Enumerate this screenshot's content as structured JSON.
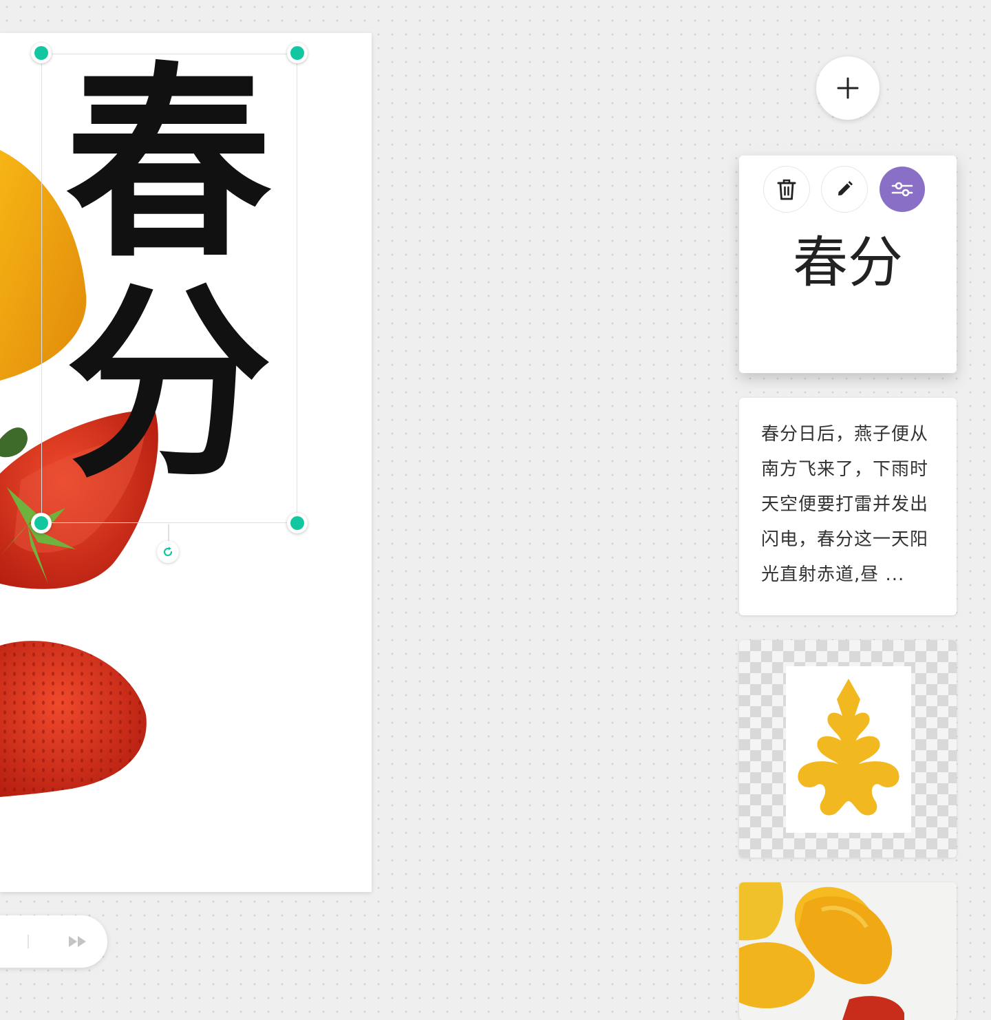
{
  "canvas": {
    "title_text": "春分",
    "title_chars": [
      "春",
      "分"
    ]
  },
  "player": {
    "fast_forward_icon": "fast-forward-icon"
  },
  "panel": {
    "add_icon": "plus-icon",
    "cards": {
      "title_card": {
        "text": "春分",
        "tools": [
          {
            "name": "delete",
            "icon": "trash-icon"
          },
          {
            "name": "edit",
            "icon": "pencil-icon"
          },
          {
            "name": "adjust",
            "icon": "sliders-icon",
            "active": true
          }
        ]
      },
      "text_card": {
        "text": "春分日后，燕子便从南方飞来了，下雨时天空便要打雷并发出闪电，春分这一天阳光直射赤道,昼 ..."
      }
    }
  },
  "colors": {
    "accent": "#12c7a0",
    "active_tool": "#8a6fc6",
    "mango": "#f4b11c",
    "strawberry": "#d8361f",
    "leaf": "#f2b81f"
  }
}
